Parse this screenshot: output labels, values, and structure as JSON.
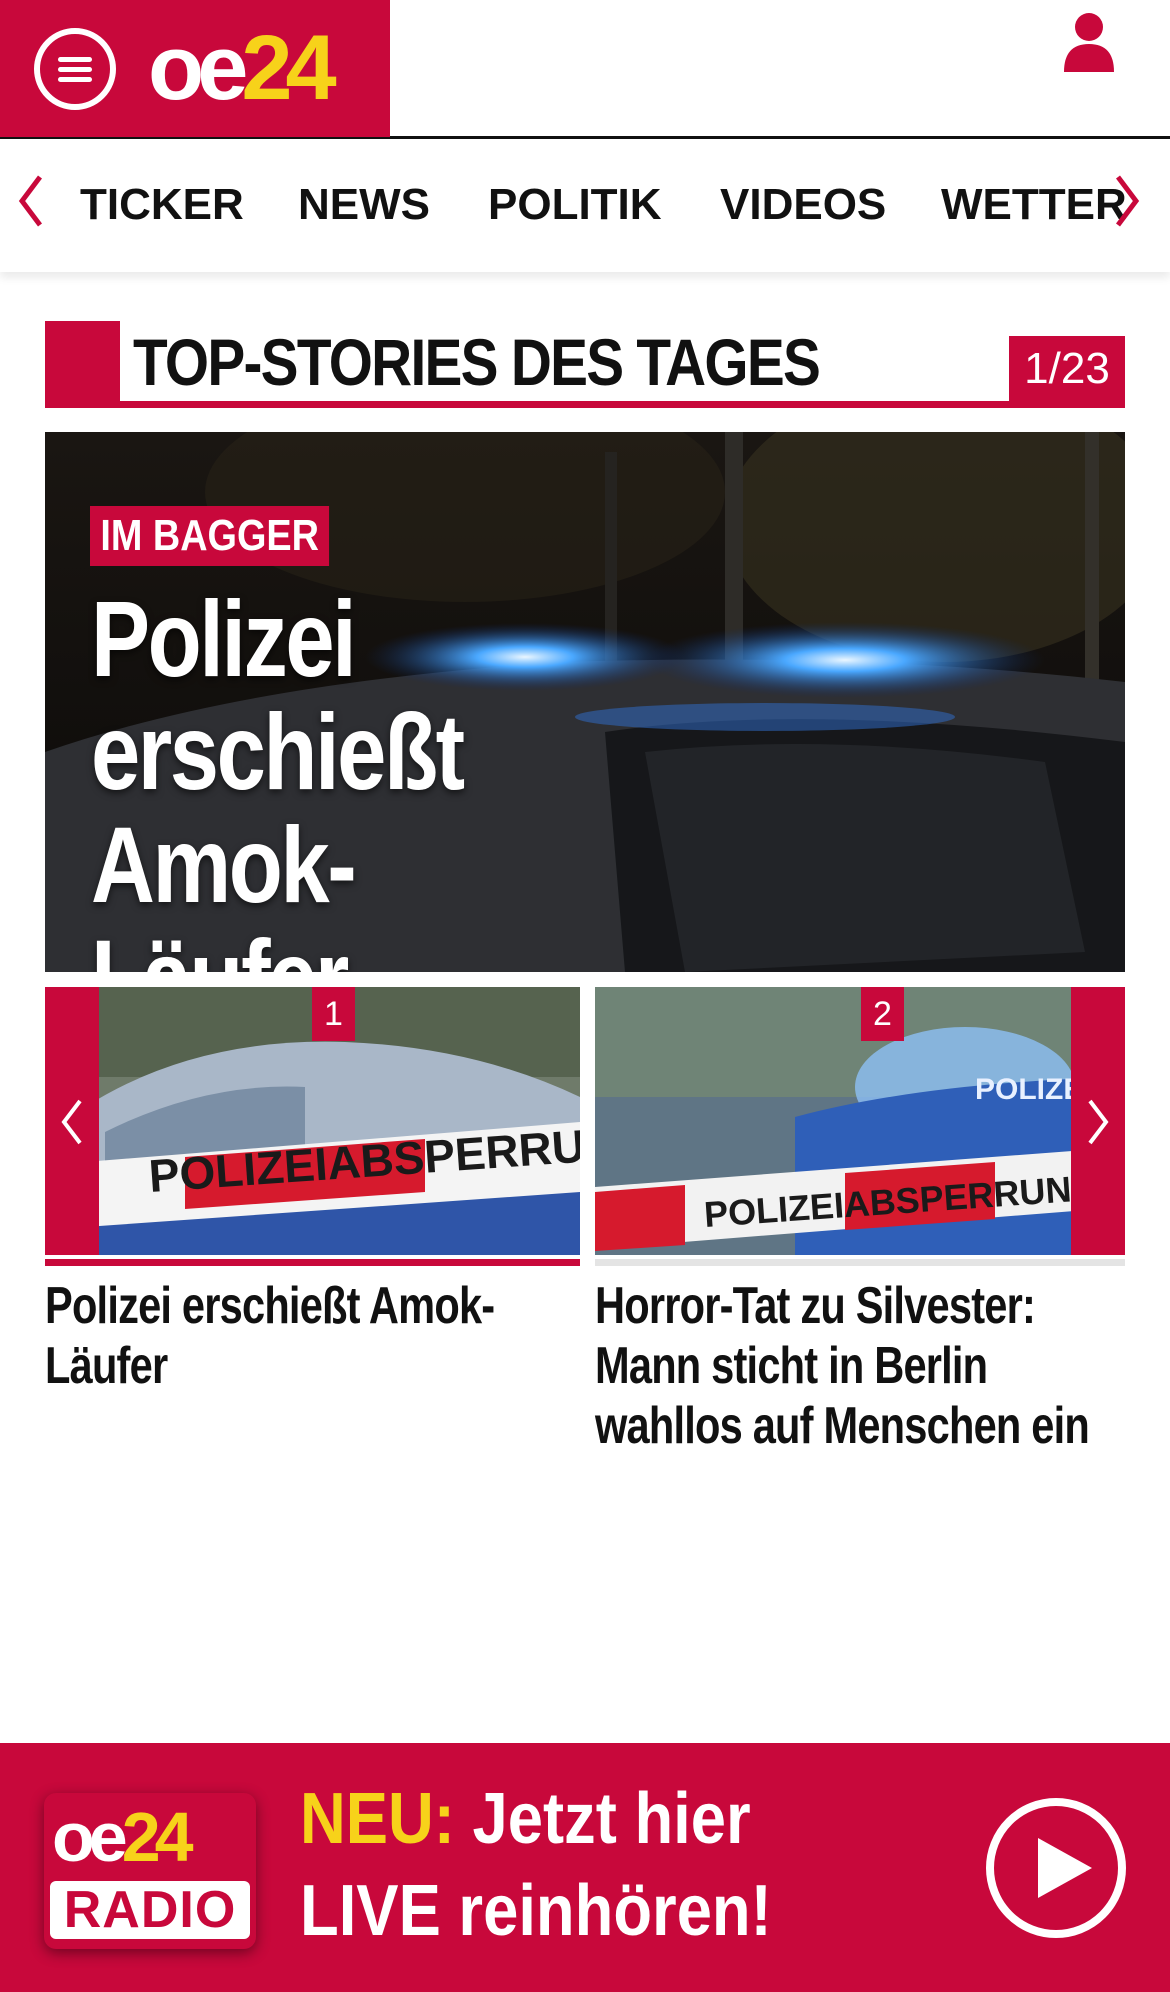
{
  "header": {
    "logo_oe": "oe",
    "logo_num": "24"
  },
  "nav": {
    "items": [
      {
        "label": "TICKER"
      },
      {
        "label": "NEWS"
      },
      {
        "label": "POLITIK"
      },
      {
        "label": "VIDEOS"
      },
      {
        "label": "WETTER"
      }
    ],
    "icons": {
      "prev": "chevron-left-icon",
      "next": "chevron-right-icon",
      "menu": "hamburger-menu-icon",
      "user": "user-icon"
    }
  },
  "top_stories": {
    "title": "TOP-STORIES DES TAGES",
    "counter": "1/23",
    "hero": {
      "kicker": "IM BAGGER",
      "title": "Polizei erschießt Amok-Läufer"
    },
    "teasers": [
      {
        "number": "1",
        "headline": "Polizei erschießt Amok-Läufer",
        "image_text": "POLIZEIABSPERRUNG"
      },
      {
        "number": "2",
        "headline": "Horror-Tat zu Silvester: Mann sticht in Berlin wahllos auf Menschen ein",
        "image_text": "POLIZEIABSPERRUNG",
        "image_text_2": "POLIZEI"
      }
    ]
  },
  "radio_banner": {
    "logo_oe": "oe",
    "logo_num": "24",
    "logo_label": "RADIO",
    "neu": "NEU:",
    "line1_rest": " Jetzt hier",
    "line2": "LIVE reinhören!"
  },
  "colors": {
    "brand_red": "#c8083b",
    "logo_yellow": "#f7d21a",
    "text": "#111111"
  }
}
